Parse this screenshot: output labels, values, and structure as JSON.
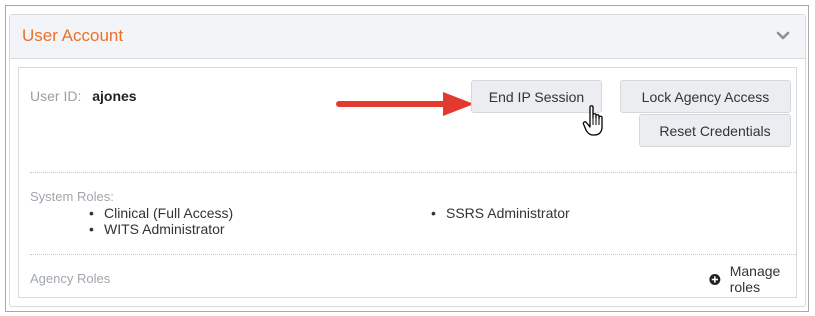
{
  "panel": {
    "title": "User Account",
    "collapse_icon": "chevron-down-icon"
  },
  "user": {
    "id_label": "User ID:",
    "id_value": "ajones"
  },
  "actions": {
    "end_ip_session_label": "End IP Session",
    "lock_agency_access_label": "Lock Agency Access",
    "reset_credentials_label": "Reset Credentials"
  },
  "system_roles": {
    "label": "System Roles:",
    "items": [
      "Clinical (Full Access)",
      "WITS Administrator",
      "SSRS Administrator"
    ]
  },
  "agency_roles": {
    "label": "Agency Roles",
    "manage_label": "Manage roles",
    "manage_icon": "plus-circle-icon"
  },
  "colors": {
    "title_orange": "#e8722c",
    "arrow_red": "#e23a2e",
    "header_bg": "#f2f4f7",
    "button_bg": "#ebedf0"
  }
}
